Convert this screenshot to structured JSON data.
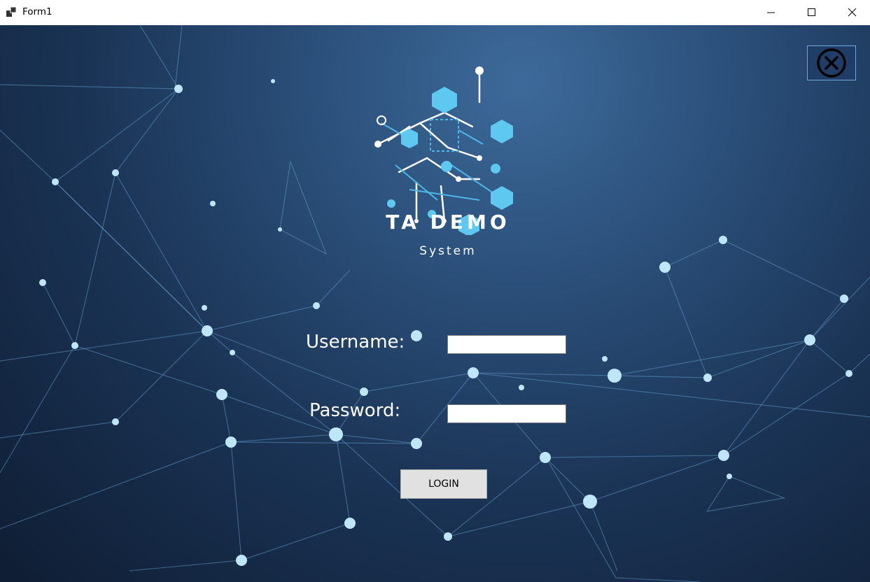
{
  "window": {
    "title": "Form1",
    "controls": [
      "minimize",
      "maximize",
      "close"
    ]
  },
  "brand": {
    "title": "TA DEMO",
    "subtitle": "System"
  },
  "form": {
    "username_label": "Username:",
    "username_value": "",
    "password_label": "Password:",
    "password_value": "",
    "login_label": "LOGIN"
  },
  "icons": {
    "app": "app-icon",
    "exit": "circle-x-icon",
    "logo": "network-cubes-logo"
  },
  "colors": {
    "background_top": "#3d6a9a",
    "background_bottom": "#0f1d33",
    "accent": "#5fc8f0",
    "text": "#ffffff",
    "button_face": "#e1e1e1"
  }
}
